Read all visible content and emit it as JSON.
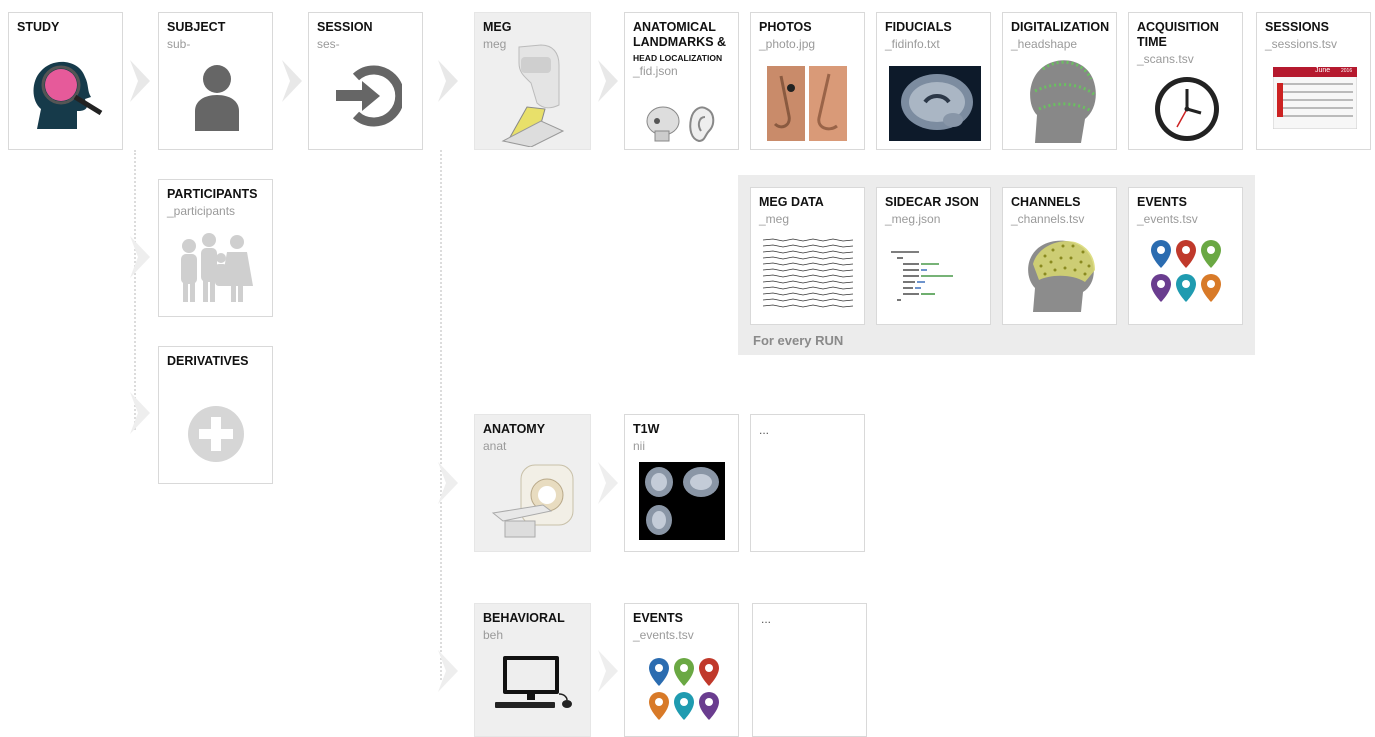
{
  "row1": {
    "study": {
      "title": "STUDY",
      "icon": "brain-magnifier-icon"
    },
    "subject": {
      "title": "SUBJECT",
      "sub": "sub-",
      "icon": "person-icon"
    },
    "session": {
      "title": "SESSION",
      "sub": "ses-",
      "icon": "login-arrow-icon"
    },
    "meg": {
      "title": "MEG",
      "sub": "meg",
      "icon": "meg-scanner-icon"
    },
    "landmarks": {
      "title_a": "ANATOMICAL",
      "title_b": "LANDMARKS",
      "title_amp": "&",
      "title_c": "HEAD LOCALIZATION",
      "sub": "_fid.json",
      "icon": "skull-ear-icon"
    },
    "photos": {
      "title": "PHOTOS",
      "sub": "_photo.jpg",
      "icon": "nose-photo-icon"
    },
    "fiducials": {
      "title": "FIDUCIALS",
      "sub": "_fidinfo.txt",
      "icon": "brain-mri-sagittal-icon"
    },
    "digitalization": {
      "title": "DIGITALIZATION",
      "sub": "_headshape",
      "icon": "head-points-icon"
    },
    "acquisition": {
      "title_a": "ACQUISITION",
      "title_b": "TIME",
      "sub": "_scans.tsv",
      "icon": "clock-icon"
    },
    "sessions": {
      "title": "SESSIONS",
      "sub": "_sessions.tsv",
      "icon": "calendar-icon",
      "cal_month": "June",
      "cal_year": "2016"
    }
  },
  "participants": {
    "title": "PARTICIPANTS",
    "sub": "_participants",
    "icon": "people-group-icon"
  },
  "derivatives": {
    "title": "DERIVATIVES",
    "icon": "plus-circle-icon"
  },
  "run": {
    "label": "For every RUN",
    "meg_data": {
      "title": "MEG DATA",
      "sub": "_meg",
      "icon": "meg-traces-icon"
    },
    "sidecar": {
      "title": "SIDECAR JSON",
      "sub": "_meg.json",
      "icon": "json-code-icon"
    },
    "channels": {
      "title": "CHANNELS",
      "sub": "_channels.tsv",
      "icon": "head-sensors-icon"
    },
    "events": {
      "title": "EVENTS",
      "sub": "_events.tsv",
      "icon": "map-pins-icon"
    }
  },
  "anatomy": {
    "title": "ANATOMY",
    "sub": "anat",
    "icon": "mri-scanner-icon"
  },
  "t1w": {
    "title": "T1W",
    "sub": "nii",
    "icon": "mri-slices-icon"
  },
  "anat_more": {
    "text": "..."
  },
  "behavioral": {
    "title": "BEHAVIORAL",
    "sub": "beh",
    "icon": "computer-icon"
  },
  "beh_events": {
    "title": "EVENTS",
    "sub": "_events.tsv",
    "icon": "map-pins-icon"
  },
  "beh_more": {
    "text": "..."
  },
  "colors": {
    "card_border": "#d9d9d9",
    "gray_card": "#efefef",
    "run_bg": "#ececec",
    "chevron": "#e6e6e6"
  }
}
